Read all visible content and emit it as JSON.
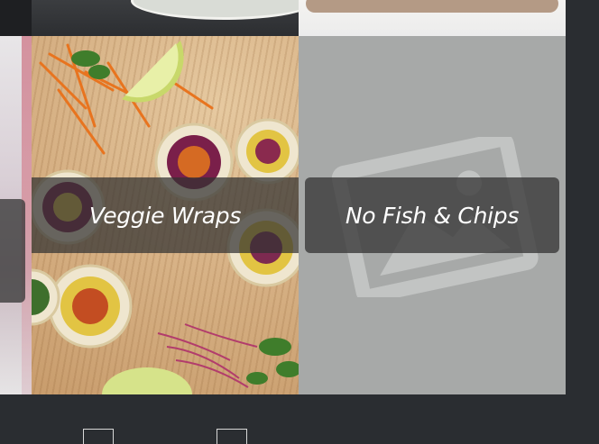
{
  "tiles": [
    {
      "id": "veggie-wraps",
      "label": "Veggie Wraps"
    },
    {
      "id": "no-fish-chips",
      "label": "No Fish & Chips"
    }
  ],
  "icons": {
    "placeholder": "image-placeholder-icon"
  },
  "colors": {
    "background": "#2a2d31",
    "label_overlay": "#373737",
    "placeholder_bg": "#a7a9a8"
  }
}
